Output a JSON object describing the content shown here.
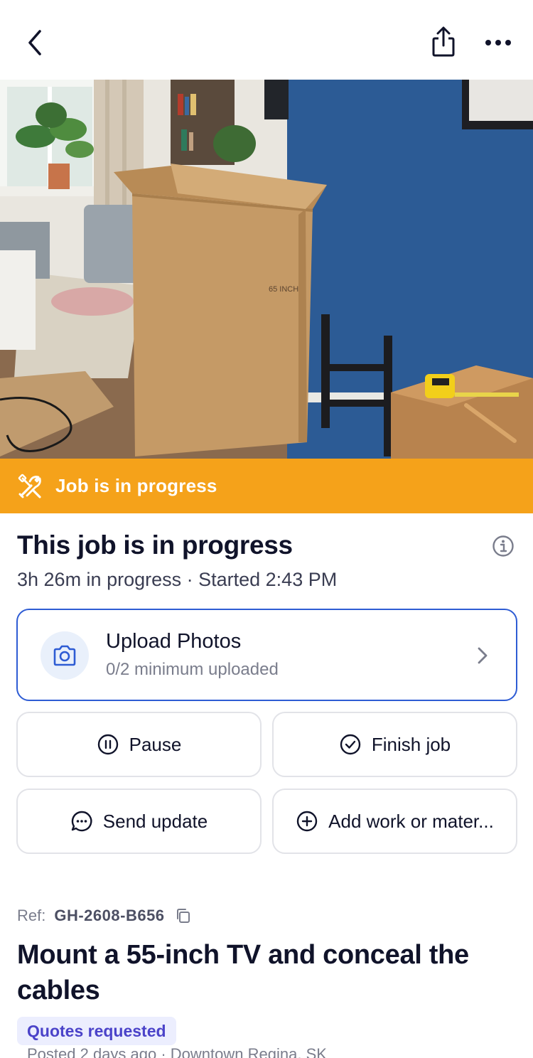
{
  "nav": {
    "back_icon": "chevron-left-icon",
    "share_icon": "share-icon",
    "more_icon": "ellipsis-icon"
  },
  "hero": {
    "box_label": "65 INCH"
  },
  "banner": {
    "text": "Job is in progress",
    "icon": "tools-icon",
    "color": "#f5a21a"
  },
  "status": {
    "title": "This job is in progress",
    "subtitle": "3h 26m in progress · Started 2:43 PM"
  },
  "upload": {
    "title": "Upload Photos",
    "subtitle": "0/2 minimum uploaded",
    "accent": "#2e5cd4"
  },
  "actions": {
    "pause": "Pause",
    "finish": "Finish job",
    "send_update": "Send update",
    "add_work": "Add work or mater..."
  },
  "job": {
    "ref_label": "Ref:",
    "ref_code": "GH-2608-B656",
    "title": "Mount a 55-inch TV and conceal the cables",
    "badge": "Quotes requested",
    "posted": "Posted 2 days ago · Downtown Regina, SK"
  }
}
